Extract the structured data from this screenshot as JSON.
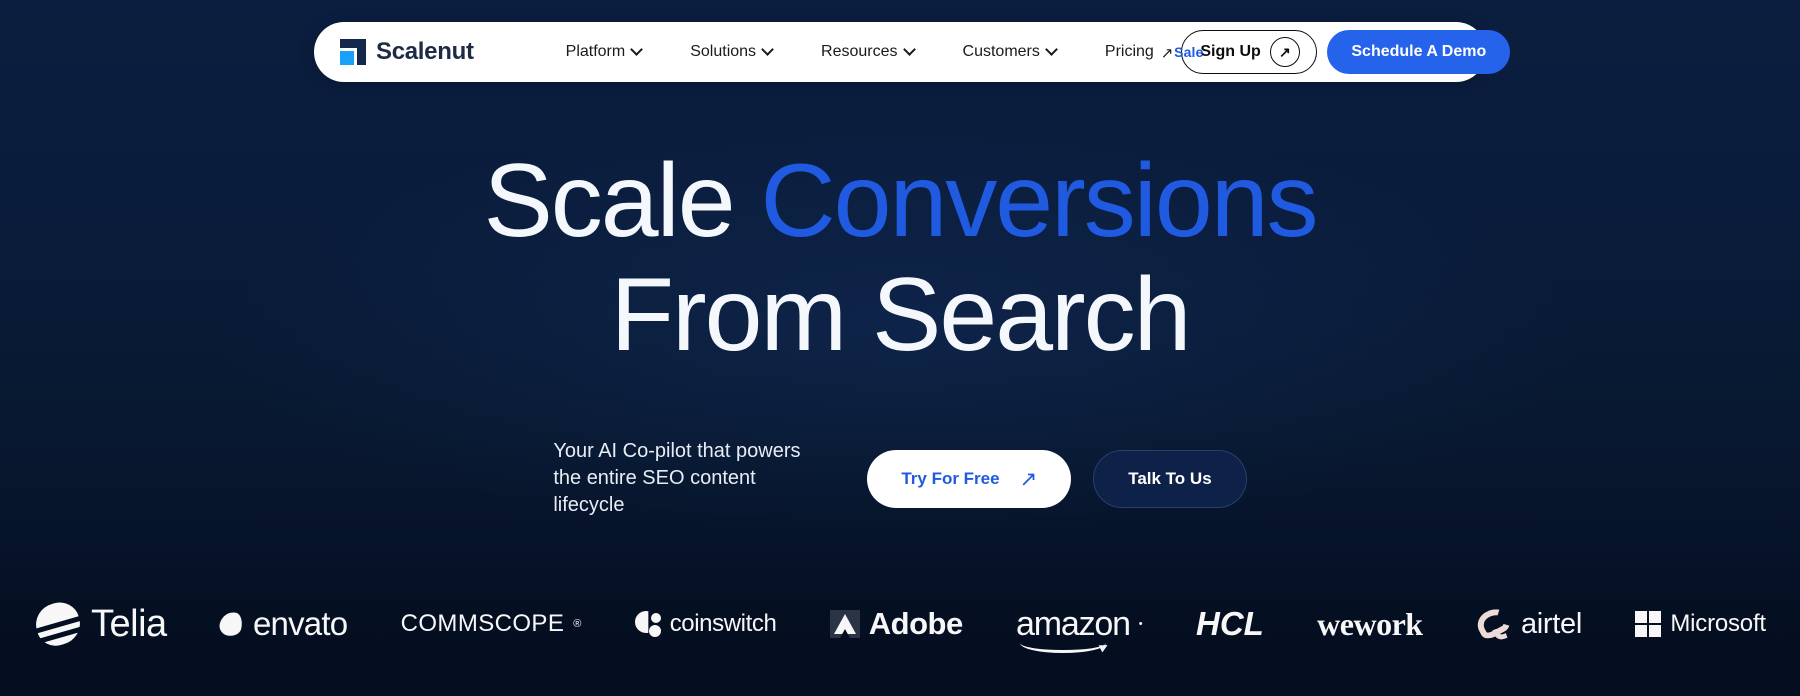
{
  "colors": {
    "bg_top": "#0b1e3f",
    "bg_bottom": "#050f22",
    "accent_blue": "#1f5ae0",
    "button_blue": "#2563eb",
    "logo_light_blue": "#18a0fb",
    "text_light": "#f4f7fb"
  },
  "navbar": {
    "brand": "Scalenut",
    "links": [
      {
        "label": "Platform",
        "icon": "chevron-down-icon"
      },
      {
        "label": "Solutions",
        "icon": "chevron-down-icon"
      },
      {
        "label": "Resources",
        "icon": "chevron-down-icon"
      },
      {
        "label": "Customers",
        "icon": "chevron-down-icon"
      }
    ],
    "pricing": {
      "label": "Pricing",
      "icon": "arrow-up-right-icon",
      "badge": "Sale"
    },
    "signup": {
      "label": "Sign Up",
      "icon": "arrow-up-right-circle-icon"
    },
    "demo": {
      "label": "Schedule A Demo"
    }
  },
  "hero": {
    "line1_white": "Scale",
    "line1_accent": "Conversions",
    "line2": "From Search",
    "subtext": "Your AI Co-pilot that powers the entire SEO content lifecycle",
    "cta_primary": {
      "label": "Try For Free",
      "icon": "arrow-up-right-icon"
    },
    "cta_secondary": {
      "label": "Talk To Us"
    }
  },
  "logos": [
    {
      "name": "Telia",
      "mark": "telia-ellipse-icon"
    },
    {
      "name": "envato",
      "mark": "envato-leaf-icon"
    },
    {
      "name": "COMMSCOPE",
      "mark": "none",
      "suffix": "®"
    },
    {
      "name": "coinswitch",
      "mark": "coinswitch-icon"
    },
    {
      "name": "Adobe",
      "mark": "adobe-a-icon"
    },
    {
      "name": "amazon",
      "mark": "amazon-smile-icon"
    },
    {
      "name": "HCL",
      "mark": "none"
    },
    {
      "name": "wework",
      "mark": "none"
    },
    {
      "name": "airtel",
      "mark": "airtel-swirl-icon"
    },
    {
      "name": "Microsoft",
      "mark": "microsoft-squares-icon"
    }
  ]
}
